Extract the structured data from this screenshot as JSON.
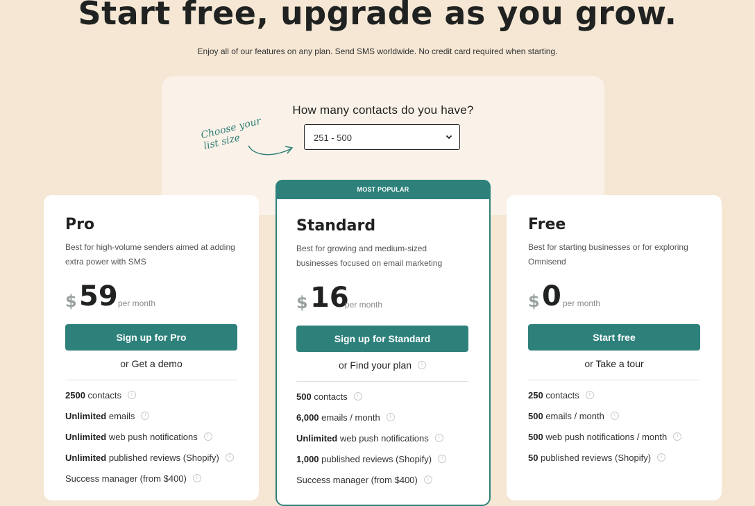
{
  "header": {
    "title": "Start free, upgrade as you grow.",
    "subtitle": "Enjoy all of our features on any plan. Send SMS worldwide. No credit card required when starting."
  },
  "selector": {
    "question": "How many contacts do you have?",
    "note_line1": "Choose your",
    "note_line2": "list size",
    "selected": "251 - 500"
  },
  "plans": [
    {
      "name": "Pro",
      "description": "Best for high-volume senders aimed at adding extra power with SMS",
      "currency": "$",
      "price": "59",
      "period": "per month",
      "cta": "Sign up for Pro",
      "alt_prefix": "or",
      "alt_link": "Get a demo",
      "features": [
        {
          "bold": "2500",
          "text": " contacts"
        },
        {
          "bold": "Unlimited",
          "text": " emails"
        },
        {
          "bold": "Unlimited",
          "text": " web push notifications"
        },
        {
          "bold": "Unlimited",
          "text": " published reviews (Shopify)"
        },
        {
          "bold": "",
          "text": "Success manager (from $400)"
        }
      ]
    },
    {
      "name": "Standard",
      "badge": "MOST POPULAR",
      "description": "Best for growing and medium-sized businesses focused on email marketing",
      "currency": "$",
      "price": "16",
      "period": "per month",
      "cta": "Sign up for Standard",
      "alt_prefix": "or",
      "alt_link": "Find your plan",
      "features": [
        {
          "bold": "500",
          "text": " contacts"
        },
        {
          "bold": "6,000",
          "text": " emails / month"
        },
        {
          "bold": "Unlimited",
          "text": " web push notifications"
        },
        {
          "bold": "1,000",
          "text": " published reviews (Shopify)"
        },
        {
          "bold": "",
          "text": "Success manager (from $400)"
        }
      ]
    },
    {
      "name": "Free",
      "description": "Best for starting businesses or for exploring Omnisend",
      "currency": "$",
      "price": "0",
      "period": "per month",
      "cta": "Start free",
      "alt_prefix": "or",
      "alt_link": "Take a tour",
      "features": [
        {
          "bold": "250",
          "text": " contacts"
        },
        {
          "bold": "500",
          "text": " emails / month"
        },
        {
          "bold": "500",
          "text": " web push notifications / month"
        },
        {
          "bold": "50",
          "text": " published reviews (Shopify)"
        }
      ]
    }
  ],
  "colors": {
    "page_bg": "#f5e7d4",
    "panel_bg": "#faf2e8",
    "accent": "#2e817b",
    "text": "#1f2220"
  },
  "icons": {
    "info": "info-circle-icon",
    "chevron": "chevron-down-icon",
    "arrow": "curved-arrow-icon"
  }
}
